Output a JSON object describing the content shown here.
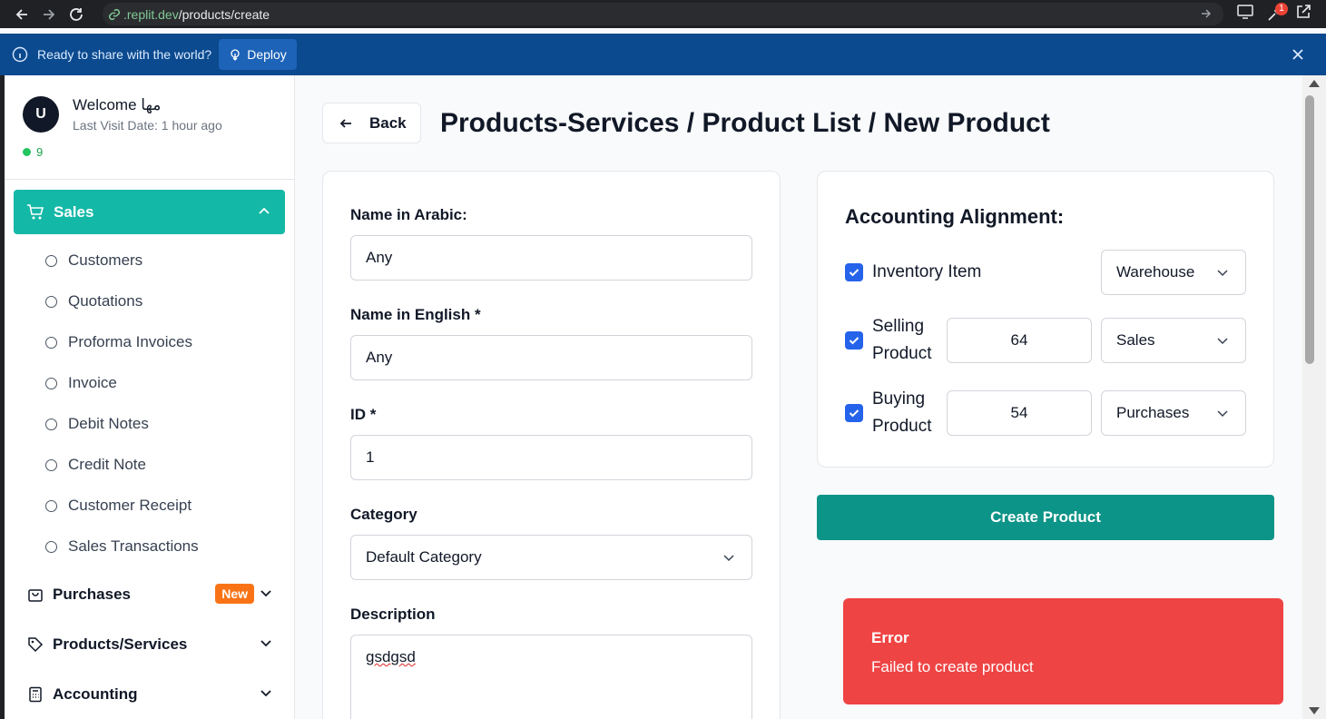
{
  "browser": {
    "url_domain": ".replit.dev",
    "url_path": "/products/create",
    "extension_badge": "1"
  },
  "banner": {
    "text": "Ready to share with the world?",
    "deploy_label": "Deploy"
  },
  "sidebar": {
    "avatar_initial": "U",
    "welcome": "Welcome مها",
    "last_visit": "Last Visit Date: 1 hour ago",
    "online_count": "9",
    "active_menu": "Sales",
    "sales_items": [
      "Customers",
      "Quotations",
      "Proforma Invoices",
      "Invoice",
      "Debit Notes",
      "Credit Note",
      "Customer Receipt",
      "Sales Transactions"
    ],
    "purchases_label": "Purchases",
    "new_badge": "New",
    "products_label": "Products/Services",
    "accounting_label": "Accounting"
  },
  "header": {
    "back_label": "Back",
    "title": "Products-Services / Product List / New Product"
  },
  "form": {
    "name_ar_label": "Name in Arabic:",
    "name_ar_value": "Any",
    "name_en_label": "Name in English *",
    "name_en_value": "Any",
    "id_label": "ID *",
    "id_value": "1",
    "category_label": "Category",
    "category_value": "Default Category",
    "description_label": "Description",
    "description_value": "gsdgsd"
  },
  "accounting": {
    "title": "Accounting Alignment:",
    "inventory_label": "Inventory Item",
    "inventory_select": "Warehouse",
    "selling_label_1": "Selling",
    "selling_label_2": "Product",
    "selling_value": "64",
    "selling_select": "Sales",
    "buying_label_1": "Buying",
    "buying_label_2": "Product",
    "buying_value": "54",
    "buying_select": "Purchases"
  },
  "create_label": "Create Product",
  "toast": {
    "title": "Error",
    "message": "Failed to create product"
  }
}
